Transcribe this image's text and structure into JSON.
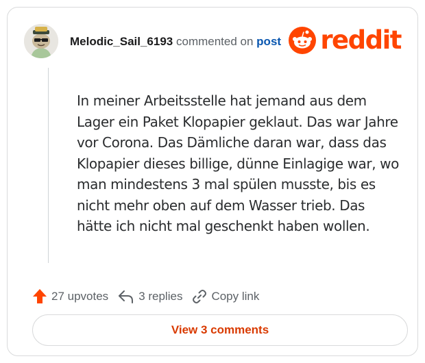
{
  "comment": {
    "username": "Melodic_Sail_6193",
    "action_text": " commented on ",
    "post_link": "post",
    "body": "In meiner Arbeitsstelle hat jemand aus dem Lager ein Paket Klopapier geklaut. Das war Jahre vor Corona. Das Dämliche daran war, dass das Klopapier dieses billige, dünne Einlagige war, wo man mindestens 3 mal spülen musste, bis es nicht mehr oben auf dem Wasser trieb. Das hätte ich nicht mal geschenkt haben wollen."
  },
  "brand": {
    "wordmark": "reddit",
    "color": "#ff4500"
  },
  "actions": {
    "upvotes": "27 upvotes",
    "replies": "3 replies",
    "copy_link": "Copy link"
  },
  "view_button": {
    "label": "View 3 comments"
  },
  "colors": {
    "accent": "#ff4500",
    "link": "#0a57b0",
    "button_text": "#d93a00"
  },
  "icons": [
    "avatar",
    "reddit-logo-icon",
    "upvote-arrow-icon",
    "reply-icon",
    "link-icon"
  ]
}
